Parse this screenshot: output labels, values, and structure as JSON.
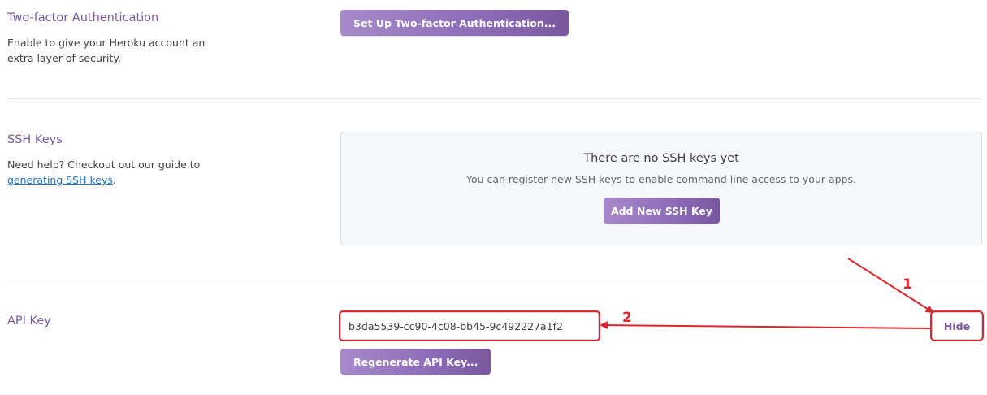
{
  "two_factor": {
    "title": "Two-factor Authentication",
    "description": "Enable to give your Heroku account an extra layer of security.",
    "button_label": "Set Up Two-factor Authentication..."
  },
  "ssh_keys": {
    "title": "SSH Keys",
    "description_prefix": "Need help? Checkout out our guide to ",
    "link_text": "generating SSH keys",
    "description_suffix": ".",
    "empty_title": "There are no SSH keys yet",
    "empty_subtitle": "You can register new SSH keys to enable command line access to your apps.",
    "button_label": "Add New SSH Key"
  },
  "api_key": {
    "title": "API Key",
    "value": "b3da5539-cc90-4c08-bb45-9c492227a1f2",
    "hide_label": "Hide",
    "regenerate_label": "Regenerate API Key..."
  },
  "annotations": {
    "label_1": "1",
    "label_2": "2",
    "color": "#d9272e"
  },
  "colors": {
    "accent": "#79589f",
    "link": "#1e73c8"
  }
}
